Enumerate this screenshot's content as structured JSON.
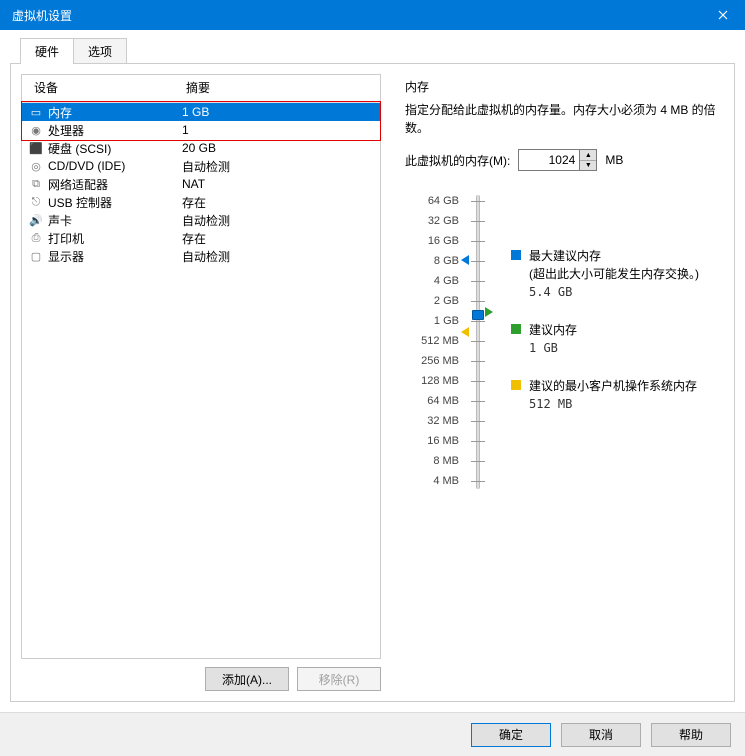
{
  "window": {
    "title": "虚拟机设置"
  },
  "tabs": {
    "hardware": "硬件",
    "options": "选项"
  },
  "headers": {
    "device": "设备",
    "summary": "摘要"
  },
  "devices": [
    {
      "icon": "▭",
      "name": "内存",
      "summary": "1 GB",
      "selected": true
    },
    {
      "icon": "◉",
      "name": "处理器",
      "summary": "1"
    },
    {
      "icon": "⬛",
      "name": "硬盘 (SCSI)",
      "summary": "20 GB"
    },
    {
      "icon": "◎",
      "name": "CD/DVD (IDE)",
      "summary": "自动检测"
    },
    {
      "icon": "⧉",
      "name": "网络适配器",
      "summary": "NAT"
    },
    {
      "icon": "⎋",
      "name": "USB 控制器",
      "summary": "存在"
    },
    {
      "icon": "🔊",
      "name": "声卡",
      "summary": "自动检测"
    },
    {
      "icon": "⎙",
      "name": "打印机",
      "summary": "存在"
    },
    {
      "icon": "▢",
      "name": "显示器",
      "summary": "自动检测"
    }
  ],
  "buttons": {
    "add": "添加(A)...",
    "remove": "移除(R)",
    "ok": "确定",
    "cancel": "取消",
    "help": "帮助"
  },
  "memory": {
    "heading": "内存",
    "desc": "指定分配给此虚拟机的内存量。内存大小必须为 4 MB 的倍数。",
    "label": "此虚拟机的内存(M):",
    "value": "1024",
    "unit": "MB",
    "scale": [
      "64 GB",
      "32 GB",
      "16 GB",
      "8 GB",
      "4 GB",
      "2 GB",
      "1 GB",
      "512 MB",
      "256 MB",
      "128 MB",
      "64 MB",
      "32 MB",
      "16 MB",
      "8 MB",
      "4 MB"
    ],
    "legend": {
      "max": {
        "label": "最大建议内存",
        "note": "(超出此大小可能发生内存交换。)",
        "value": "5.4 GB"
      },
      "rec": {
        "label": "建议内存",
        "value": "1 GB"
      },
      "min": {
        "label": "建议的最小客户机操作系统内存",
        "value": "512 MB"
      }
    }
  }
}
